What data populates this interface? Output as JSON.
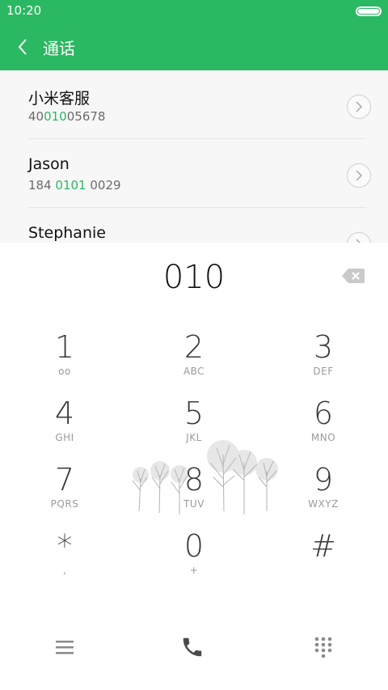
{
  "status_bar": {
    "time": "10:20"
  },
  "header": {
    "title": "通话"
  },
  "results": [
    {
      "name": "小米客服",
      "number_before": "40",
      "number_match": "010",
      "number_after": "05678"
    },
    {
      "name": "Jason",
      "number_before": "184 ",
      "number_match": "0101",
      "number_after": " 0029"
    },
    {
      "name": "Stephanie",
      "number_before": "",
      "number_match": "",
      "number_after": ""
    }
  ],
  "dialer": {
    "input": "010",
    "keys": [
      {
        "digit": "1",
        "letters": "ᴏᴏ"
      },
      {
        "digit": "2",
        "letters": "ABC"
      },
      {
        "digit": "3",
        "letters": "DEF"
      },
      {
        "digit": "4",
        "letters": "GHI"
      },
      {
        "digit": "5",
        "letters": "JKL"
      },
      {
        "digit": "6",
        "letters": "MNO"
      },
      {
        "digit": "7",
        "letters": "PQRS"
      },
      {
        "digit": "8",
        "letters": "TUV"
      },
      {
        "digit": "9",
        "letters": "WXYZ"
      },
      {
        "digit": "*",
        "letters": ","
      },
      {
        "digit": "0",
        "letters": "+"
      },
      {
        "digit": "#",
        "letters": ""
      }
    ]
  },
  "bottom_bar": {
    "icons": [
      "menu-icon",
      "phone-icon",
      "keypad-icon"
    ]
  },
  "colors": {
    "accent": "#2bb862",
    "match_highlight": "#2bb862"
  }
}
